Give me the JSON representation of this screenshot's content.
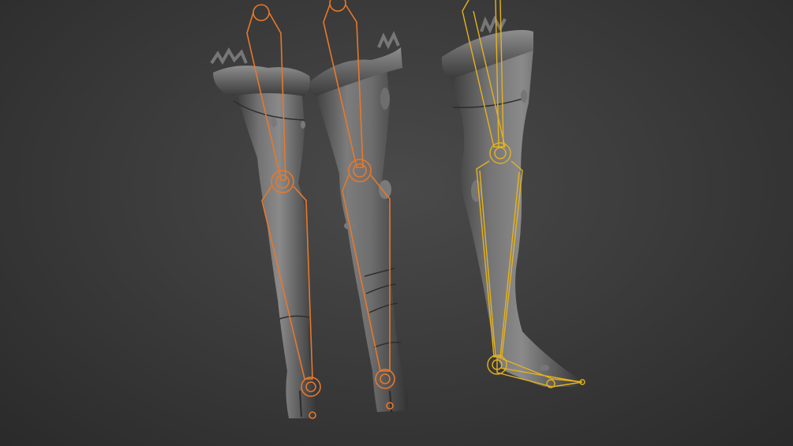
{
  "scene": {
    "background": "#3b3b3b",
    "mesh_color": "#5e5e5e",
    "mesh_highlight": "#8a8a8a",
    "mesh_shadow": "#2f2f2f",
    "bone_color_selected": "#e8782a",
    "bone_color_active": "#e6b21e",
    "objects": [
      "leg-mesh-left",
      "leg-mesh-middle",
      "leg-mesh-right-side-view"
    ],
    "rigs": [
      "orange-leg-rig-left",
      "orange-leg-rig-middle",
      "yellow-leg-rig-right"
    ]
  }
}
